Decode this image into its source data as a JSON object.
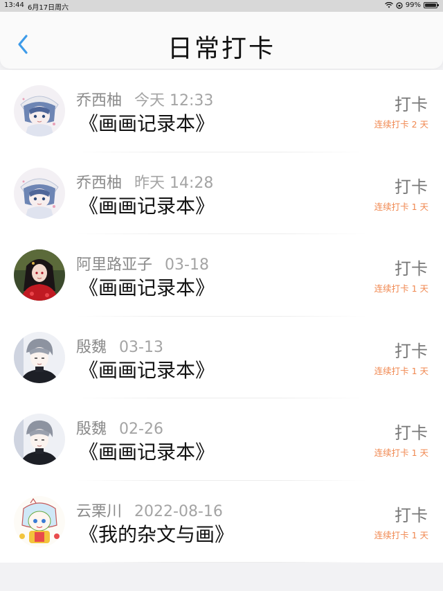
{
  "status_bar": {
    "time": "13:44",
    "date": "6月17日周六",
    "battery": "99%",
    "battery_level": 0.99
  },
  "header": {
    "title": "日常打卡",
    "back_icon": "chevron-left-icon",
    "accent_color": "#3d9be9"
  },
  "items": [
    {
      "user": "乔西柚",
      "time": "今天 12:33",
      "work": "《画画记录本》",
      "checkin_label": "打卡",
      "streak": "连续打卡 2 天",
      "avatar": "anime-girl-blue-hat"
    },
    {
      "user": "乔西柚",
      "time": "昨天 14:28",
      "work": "《画画记录本》",
      "checkin_label": "打卡",
      "streak": "连续打卡 1 天",
      "avatar": "anime-girl-blue-hat"
    },
    {
      "user": "阿里路亚子",
      "time": "03-18",
      "work": "《画画记录本》",
      "checkin_label": "打卡",
      "streak": "连续打卡 1 天",
      "avatar": "anime-woman-red-dress"
    },
    {
      "user": "殷魏",
      "time": "03-13",
      "work": "《画画记录本》",
      "checkin_label": "打卡",
      "streak": "连续打卡 1 天",
      "avatar": "anime-boy-grey-hair"
    },
    {
      "user": "殷魏",
      "time": "02-26",
      "work": "《画画记录本》",
      "checkin_label": "打卡",
      "streak": "连续打卡 1 天",
      "avatar": "anime-boy-grey-hair"
    },
    {
      "user": "云栗川",
      "time": "2022-08-16",
      "work": "《我的杂文与画》",
      "checkin_label": "打卡",
      "streak": "连续打卡 1 天",
      "avatar": "chibi-character-colorful"
    }
  ],
  "colors": {
    "streak": "#f0874f",
    "username": "#8a8a8a",
    "background": "#f2f2f4"
  }
}
